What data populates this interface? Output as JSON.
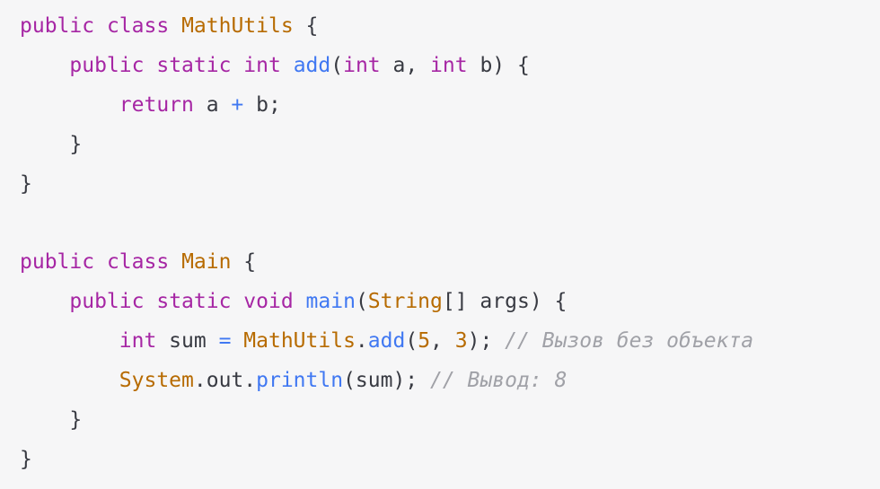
{
  "editor": {
    "colors": {
      "background": "#f6f6f7",
      "plain": "#383a42",
      "keyword": "#a626a4",
      "type": "#b76b01",
      "function": "#4078f2",
      "comment": "#a0a1a7"
    },
    "lines": [
      [
        [
          "kw",
          "public"
        ],
        [
          "pl",
          " "
        ],
        [
          "kw",
          "class"
        ],
        [
          "pl",
          " "
        ],
        [
          "ty",
          "MathUtils"
        ],
        [
          "pl",
          " {"
        ]
      ],
      [
        [
          "pl",
          "    "
        ],
        [
          "kw",
          "public"
        ],
        [
          "pl",
          " "
        ],
        [
          "kw",
          "static"
        ],
        [
          "pl",
          " "
        ],
        [
          "kw",
          "int"
        ],
        [
          "pl",
          " "
        ],
        [
          "fn",
          "add"
        ],
        [
          "pl",
          "("
        ],
        [
          "kw",
          "int"
        ],
        [
          "pl",
          " a, "
        ],
        [
          "kw",
          "int"
        ],
        [
          "pl",
          " b) {"
        ]
      ],
      [
        [
          "pl",
          "        "
        ],
        [
          "kw",
          "return"
        ],
        [
          "pl",
          " a "
        ],
        [
          "op",
          "+"
        ],
        [
          "pl",
          " b;"
        ]
      ],
      [
        [
          "pl",
          "    }"
        ]
      ],
      [
        [
          "pl",
          "}"
        ]
      ],
      [
        [
          "pl",
          ""
        ]
      ],
      [
        [
          "kw",
          "public"
        ],
        [
          "pl",
          " "
        ],
        [
          "kw",
          "class"
        ],
        [
          "pl",
          " "
        ],
        [
          "ty",
          "Main"
        ],
        [
          "pl",
          " {"
        ]
      ],
      [
        [
          "pl",
          "    "
        ],
        [
          "kw",
          "public"
        ],
        [
          "pl",
          " "
        ],
        [
          "kw",
          "static"
        ],
        [
          "pl",
          " "
        ],
        [
          "kw",
          "void"
        ],
        [
          "pl",
          " "
        ],
        [
          "fn",
          "main"
        ],
        [
          "pl",
          "("
        ],
        [
          "ty",
          "String"
        ],
        [
          "pl",
          "[] args) {"
        ]
      ],
      [
        [
          "pl",
          "        "
        ],
        [
          "kw",
          "int"
        ],
        [
          "pl",
          " sum "
        ],
        [
          "op",
          "="
        ],
        [
          "pl",
          " "
        ],
        [
          "ty",
          "MathUtils"
        ],
        [
          "pl",
          "."
        ],
        [
          "fn",
          "add"
        ],
        [
          "pl",
          "("
        ],
        [
          "num",
          "5"
        ],
        [
          "pl",
          ", "
        ],
        [
          "num",
          "3"
        ],
        [
          "pl",
          "); "
        ],
        [
          "cm",
          "// Вызов без объекта"
        ]
      ],
      [
        [
          "pl",
          "        "
        ],
        [
          "ty",
          "System"
        ],
        [
          "pl",
          ".out."
        ],
        [
          "fn",
          "println"
        ],
        [
          "pl",
          "(sum); "
        ],
        [
          "cm",
          "// Вывод: 8"
        ]
      ],
      [
        [
          "pl",
          "    }"
        ]
      ],
      [
        [
          "pl",
          "}"
        ]
      ]
    ]
  }
}
